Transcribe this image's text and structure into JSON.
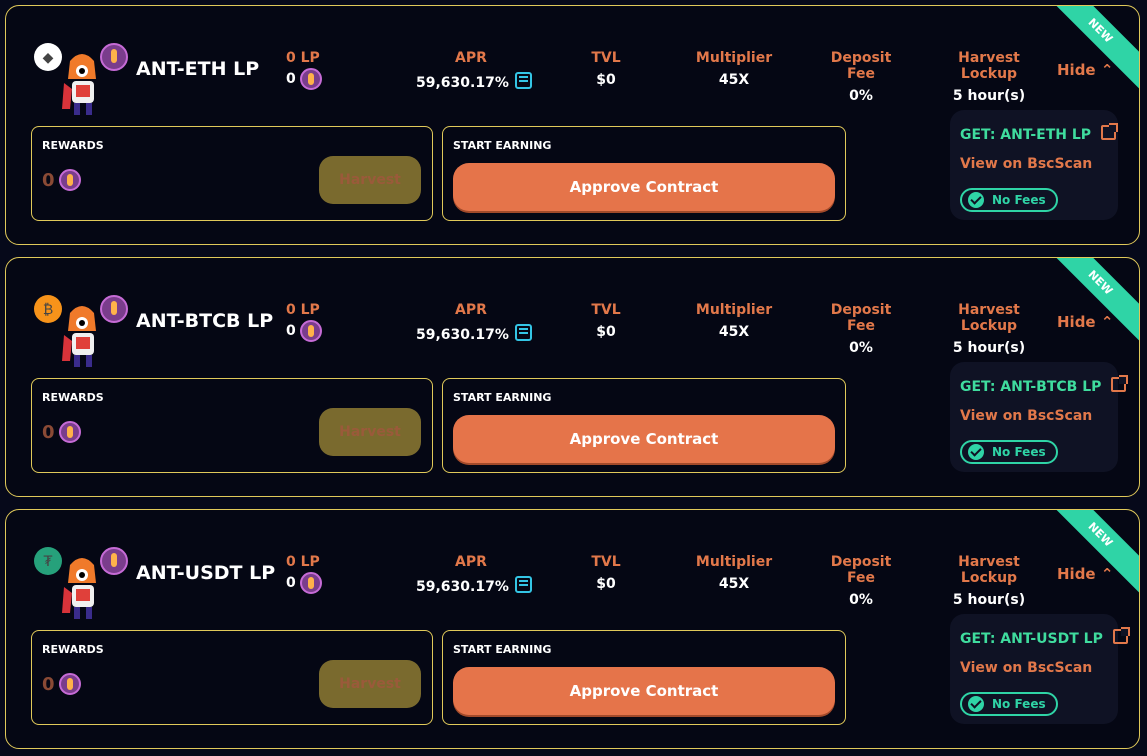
{
  "colors": {
    "accent": "#e2784a",
    "border": "#e0c95a",
    "green": "#3fdc9e",
    "teal": "#2fd4a6",
    "background": "#06091a"
  },
  "farms": [
    {
      "badge": "NEW",
      "pair_name": "ANT-ETH LP",
      "base_token_icon": "eth-icon",
      "base_token_color": "#ffffff",
      "base_token_glyph": "◆",
      "lp_label": "0 LP",
      "lp_value": "0",
      "apr_label": "APR",
      "apr_value": "59,630.17%",
      "tvl_label": "TVL",
      "tvl_value": "$0",
      "multiplier_label": "Multiplier",
      "multiplier_value": "45X",
      "deposit_fee_label": "Deposit Fee",
      "deposit_fee_value": "0%",
      "harvest_lockup_label": "Harvest Lockup",
      "harvest_lockup_value": "5 hour(s)",
      "hide_label": "Hide ⌃",
      "rewards_title": "REWARDS",
      "rewards_value": "0",
      "harvest_label": "Harvest",
      "start_earning_title": "START EARNING",
      "approve_label": "Approve Contract",
      "get_link": "GET: ANT-ETH LP",
      "bscscan_link": "View on BscScan",
      "no_fees_label": "No Fees"
    },
    {
      "badge": "NEW",
      "pair_name": "ANT-BTCB LP",
      "base_token_icon": "btc-icon",
      "base_token_color": "#f7931a",
      "base_token_glyph": "₿",
      "lp_label": "0 LP",
      "lp_value": "0",
      "apr_label": "APR",
      "apr_value": "59,630.17%",
      "tvl_label": "TVL",
      "tvl_value": "$0",
      "multiplier_label": "Multiplier",
      "multiplier_value": "45X",
      "deposit_fee_label": "Deposit Fee",
      "deposit_fee_value": "0%",
      "harvest_lockup_label": "Harvest Lockup",
      "harvest_lockup_value": "5 hour(s)",
      "hide_label": "Hide ⌃",
      "rewards_title": "REWARDS",
      "rewards_value": "0",
      "harvest_label": "Harvest",
      "start_earning_title": "START EARNING",
      "approve_label": "Approve Contract",
      "get_link": "GET: ANT-BTCB LP",
      "bscscan_link": "View on BscScan",
      "no_fees_label": "No Fees"
    },
    {
      "badge": "NEW",
      "pair_name": "ANT-USDT LP",
      "base_token_icon": "usdt-icon",
      "base_token_color": "#26a17b",
      "base_token_glyph": "₮",
      "lp_label": "0 LP",
      "lp_value": "0",
      "apr_label": "APR",
      "apr_value": "59,630.17%",
      "tvl_label": "TVL",
      "tvl_value": "$0",
      "multiplier_label": "Multiplier",
      "multiplier_value": "45X",
      "deposit_fee_label": "Deposit Fee",
      "deposit_fee_value": "0%",
      "harvest_lockup_label": "Harvest Lockup",
      "harvest_lockup_value": "5 hour(s)",
      "hide_label": "Hide ⌃",
      "rewards_title": "REWARDS",
      "rewards_value": "0",
      "harvest_label": "Harvest",
      "start_earning_title": "START EARNING",
      "approve_label": "Approve Contract",
      "get_link": "GET: ANT-USDT LP",
      "bscscan_link": "View on BscScan",
      "no_fees_label": "No Fees"
    }
  ]
}
